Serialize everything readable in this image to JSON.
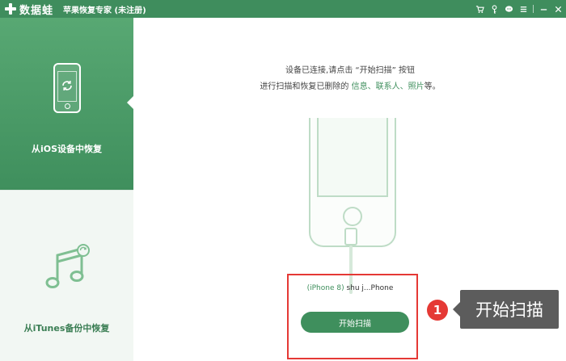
{
  "titlebar": {
    "logo_text": "数据蛙",
    "title": "苹果恢复专家 (未注册)",
    "icons": [
      "cart-icon",
      "key-icon",
      "chat-icon",
      "menu-icon",
      "minimize-icon",
      "close-icon"
    ]
  },
  "sidebar": {
    "items": [
      {
        "label": "从iOS设备中恢复",
        "icon": "phone-sync-icon",
        "active": true
      },
      {
        "label": "从iTunes备份中恢复",
        "icon": "music-icon",
        "active": false
      }
    ]
  },
  "main": {
    "instruction_line1": "设备已连接,请点击 “开始扫描” 按钮",
    "instruction_line2_prefix": "进行扫描和恢复已删除的 ",
    "instruction_line2_highlight": "信息、联系人、照片",
    "instruction_line2_suffix": "等。",
    "device_model": "(iPhone 8)",
    "device_name": " shu j...Phone",
    "scan_button": "开始扫描"
  },
  "annotation": {
    "step_number": "1",
    "callout_text": "开始扫描"
  },
  "colors": {
    "brand_green": "#3f8f5d",
    "highlight_red": "#e53935",
    "callout_gray": "#5c5c5c"
  }
}
